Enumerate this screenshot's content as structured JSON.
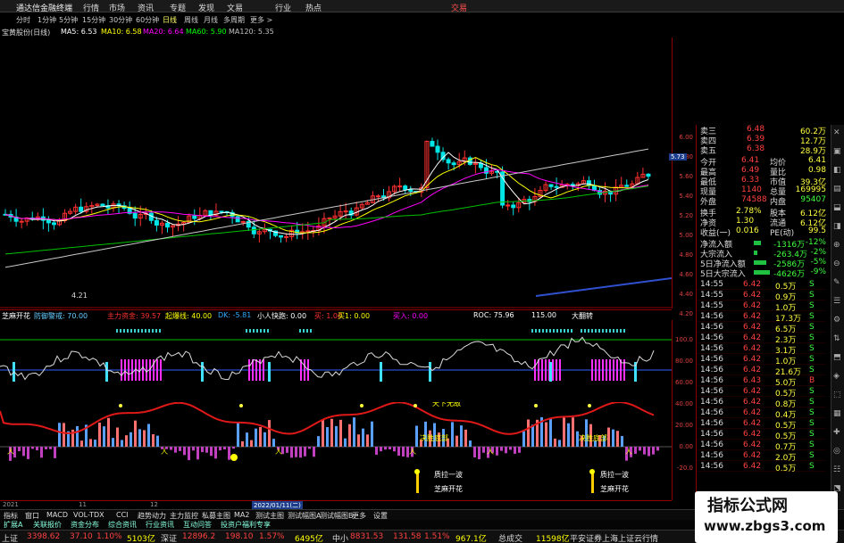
{
  "menu": {
    "logo": "通达信金融终端",
    "items": [
      "行情",
      "市场",
      "资讯",
      "专题",
      "发现",
      "文易",
      "行业",
      "热点"
    ],
    "right": "交易"
  },
  "periods": [
    "分时",
    "1分钟",
    "5分钟",
    "15分钟",
    "30分钟",
    "60分钟",
    "日线",
    "周线",
    "月线",
    "多周期",
    "更多 >"
  ],
  "main": {
    "stock": "宝黄股份(日线)",
    "ma": [
      {
        "label": "MA5: 6.53",
        "color": "#ffffff"
      },
      {
        "label": "MA10: 6.58",
        "color": "#ffff00"
      },
      {
        "label": "MA20: 6.64",
        "color": "#ff00ff"
      },
      {
        "label": "MA60: 5.90",
        "color": "#00ff00"
      },
      {
        "label": "MA120: 5.35",
        "color": "#c0c0c0"
      }
    ],
    "low_label": "4.21",
    "price_tag": "5.73",
    "axis": [
      "6.00",
      "5.80",
      "5.60",
      "5.40",
      "5.20",
      "5.00",
      "4.80",
      "4.60",
      "4.40",
      "4.20"
    ]
  },
  "ind1": {
    "items": [
      {
        "t": "芝麻开花",
        "c": "#ffffff"
      },
      {
        "t": "防御警戒: 70.00",
        "c": "#66ccff"
      },
      {
        "t": "主力资金: 39.57",
        "c": "#ff3030"
      },
      {
        "t": "起爆线: 40.00",
        "c": "#ffff00"
      },
      {
        "t": "DK: -5.81",
        "c": "#33aaff"
      },
      {
        "t": "小人快跑: 0.00",
        "c": "#ffffff"
      },
      {
        "t": "买: 1.00",
        "c": "#ff3030"
      },
      {
        "t": "买1: 0.00",
        "c": "#ffff00"
      },
      {
        "t": "买入: 0.00",
        "c": "#ff00ff"
      },
      {
        "t": "ROC: 75.96",
        "c": "#ffffff"
      },
      {
        "t": "115.00",
        "c": "#ffffff"
      },
      {
        "t": "大翻转",
        "c": "#ffffff"
      }
    ],
    "axis": [
      "100.0",
      "80.00",
      "60.00",
      "40.00",
      "20.00",
      "0.00",
      "-20.0"
    ]
  },
  "ind2": {
    "annot": [
      {
        "t": "天下无敌",
        "c": "#ffff00"
      },
      {
        "t": "决胜底部",
        "c": "#ffff00"
      },
      {
        "t": "决胜底部",
        "c": "#ffff00"
      },
      {
        "t": "质拉一波",
        "c": "#ffffff"
      },
      {
        "t": "芝麻开花",
        "c": "#ffffff"
      },
      {
        "t": "质拉一波",
        "c": "#ffffff"
      },
      {
        "t": "芝麻开花",
        "c": "#ffffff"
      }
    ]
  },
  "dates": [
    "2021",
    "11",
    "12",
    "2022/01/11(二)"
  ],
  "quote": {
    "top": [
      {
        "l": "卖三",
        "p": "6.48",
        "v": "60.2万"
      },
      {
        "l": "卖四",
        "p": "6.39",
        "v": "12.7万"
      },
      {
        "l": "卖五",
        "p": "6.38",
        "v": "28.9万"
      }
    ],
    "stats": [
      {
        "l": "今开",
        "v": "6.41",
        "l2": "均价",
        "v2": "6.41"
      },
      {
        "l": "最高",
        "v": "6.49",
        "l2": "量比",
        "v2": "0.98"
      },
      {
        "l": "最低",
        "v": "6.33",
        "l2": "市值",
        "v2": "39.3亿"
      },
      {
        "l": "现量",
        "v": "1140",
        "l2": "总量",
        "v2": "169995"
      },
      {
        "l": "外盘",
        "v": "74588",
        "l2": "内盘",
        "v2": "95407"
      }
    ],
    "stats2": [
      {
        "l": "换手",
        "v": "2.78%",
        "l2": "股本",
        "v2": "6.12亿"
      },
      {
        "l": "净资",
        "v": "1.30",
        "l2": "流通",
        "v2": "6.12亿"
      },
      {
        "l": "收益(一)",
        "v": "0.016",
        "l2": "PE(动)",
        "v2": "99.5"
      }
    ],
    "flow": [
      {
        "l": "净流入额",
        "v": "-1316万",
        "p": "-12%"
      },
      {
        "l": "大宗流入",
        "v": "-263.4万",
        "p": "-2%"
      },
      {
        "l": "5日净流入额",
        "v": "-2586万",
        "p": "-5%"
      },
      {
        "l": "5日大宗流入",
        "v": "-4626万",
        "p": "-9%"
      }
    ],
    "ticks": [
      {
        "t": "14:55",
        "p": "6.42",
        "v": "0.5万",
        "s": "S"
      },
      {
        "t": "14:55",
        "p": "6.42",
        "v": "0.9万",
        "s": "S"
      },
      {
        "t": "14:55",
        "p": "6.42",
        "v": "1.0万",
        "s": "S"
      },
      {
        "t": "14:56",
        "p": "6.42",
        "v": "17.3万",
        "s": "S"
      },
      {
        "t": "14:56",
        "p": "6.42",
        "v": "6.5万",
        "s": "S"
      },
      {
        "t": "14:56",
        "p": "6.42",
        "v": "2.3万",
        "s": "S"
      },
      {
        "t": "14:56",
        "p": "6.42",
        "v": "3.1万",
        "s": "S"
      },
      {
        "t": "14:56",
        "p": "6.42",
        "v": "1.0万",
        "s": "S"
      },
      {
        "t": "14:56",
        "p": "6.42",
        "v": "21.6万",
        "s": "S"
      },
      {
        "t": "14:56",
        "p": "6.43",
        "v": "5.0万",
        "s": "B"
      },
      {
        "t": "14:56",
        "p": "6.42",
        "v": "0.5万",
        "s": "S"
      },
      {
        "t": "14:56",
        "p": "6.42",
        "v": "0.8万",
        "s": "S"
      },
      {
        "t": "14:56",
        "p": "6.42",
        "v": "0.4万",
        "s": "S"
      },
      {
        "t": "14:56",
        "p": "6.42",
        "v": "0.5万",
        "s": "S"
      },
      {
        "t": "14:56",
        "p": "6.42",
        "v": "0.5万",
        "s": "S"
      },
      {
        "t": "14:56",
        "p": "6.42",
        "v": "0.7万",
        "s": "S"
      },
      {
        "t": "14:56",
        "p": "6.42",
        "v": "2.0万",
        "s": "S"
      },
      {
        "t": "14:56",
        "p": "6.42",
        "v": "0.5万",
        "s": "S"
      }
    ]
  },
  "tabs": [
    "指标",
    "窗口",
    "MACD",
    "VOL-TDX",
    "CCI",
    "趋势动力",
    "主力监控",
    "私募主图",
    "MA2",
    "测试主图",
    "测试幅图A",
    "测试幅图B",
    "更多",
    "设置"
  ],
  "tabs2": [
    "扩展A",
    "关联报价",
    "资金分布",
    "综合资讯",
    "行业资讯",
    "互动问答",
    "投资户福利专享"
  ],
  "status": [
    {
      "t": "上证",
      "c": "#ddd"
    },
    {
      "t": "3398.62",
      "c": "#ff4040"
    },
    {
      "t": "37.10",
      "c": "#ff4040"
    },
    {
      "t": "1.10%",
      "c": "#ff4040"
    },
    {
      "t": "5103亿",
      "c": "#ffff00"
    },
    {
      "t": "深证",
      "c": "#ddd"
    },
    {
      "t": "12896.2",
      "c": "#ff4040"
    },
    {
      "t": "198.10",
      "c": "#ff4040"
    },
    {
      "t": "1.57%",
      "c": "#ff4040"
    },
    {
      "t": "6495亿",
      "c": "#ffff00"
    },
    {
      "t": "中小",
      "c": "#ddd"
    },
    {
      "t": "8831.53",
      "c": "#ff4040"
    },
    {
      "t": "131.58",
      "c": "#ff4040"
    },
    {
      "t": "1.51%",
      "c": "#ff4040"
    },
    {
      "t": "967.1亿",
      "c": "#ffff00"
    },
    {
      "t": "总成交",
      "c": "#ddd"
    },
    {
      "t": "11598亿",
      "c": "#ffff00"
    },
    {
      "t": "平安证券上海上证云行情",
      "c": "#ddd"
    }
  ],
  "watermark": {
    "title": "指标公式网",
    "url": "www.zbgs3.com"
  },
  "chart_data": {
    "type": "candlestick",
    "note": "",
    "axis_y": [
      4.2,
      6.0
    ]
  }
}
